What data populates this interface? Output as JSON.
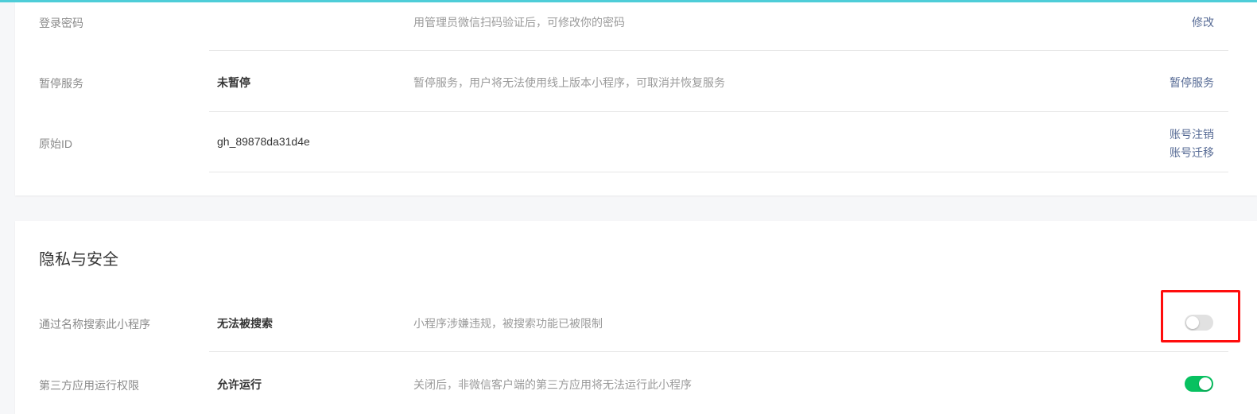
{
  "colors": {
    "accent_top": "#4ecdd8",
    "link": "#576b95",
    "switch_on": "#07c160",
    "switch_off": "#e1e1e1",
    "highlight": "#ff0d0d"
  },
  "account_section": {
    "rows": [
      {
        "label": "登录密码",
        "value": "",
        "description": "用管理员微信扫码验证后，可修改你的密码",
        "actions": [
          "修改"
        ]
      },
      {
        "label": "暂停服务",
        "value": "未暂停",
        "description": "暂停服务，用户将无法使用线上版本小程序，可取消并恢复服务",
        "actions": [
          "暂停服务"
        ]
      },
      {
        "label": "原始ID",
        "value": "gh_89878da31d4e",
        "description": "",
        "actions": [
          "账号注销",
          "账号迁移"
        ]
      }
    ]
  },
  "privacy_section": {
    "title": "隐私与安全",
    "rows": [
      {
        "label": "通过名称搜索此小程序",
        "value": "无法被搜索",
        "description": "小程序涉嫌违规，被搜索功能已被限制",
        "switch_on": false
      },
      {
        "label": "第三方应用运行权限",
        "value": "允许运行",
        "description": "关闭后，非微信客户端的第三方应用将无法运行此小程序",
        "switch_on": true
      }
    ]
  }
}
